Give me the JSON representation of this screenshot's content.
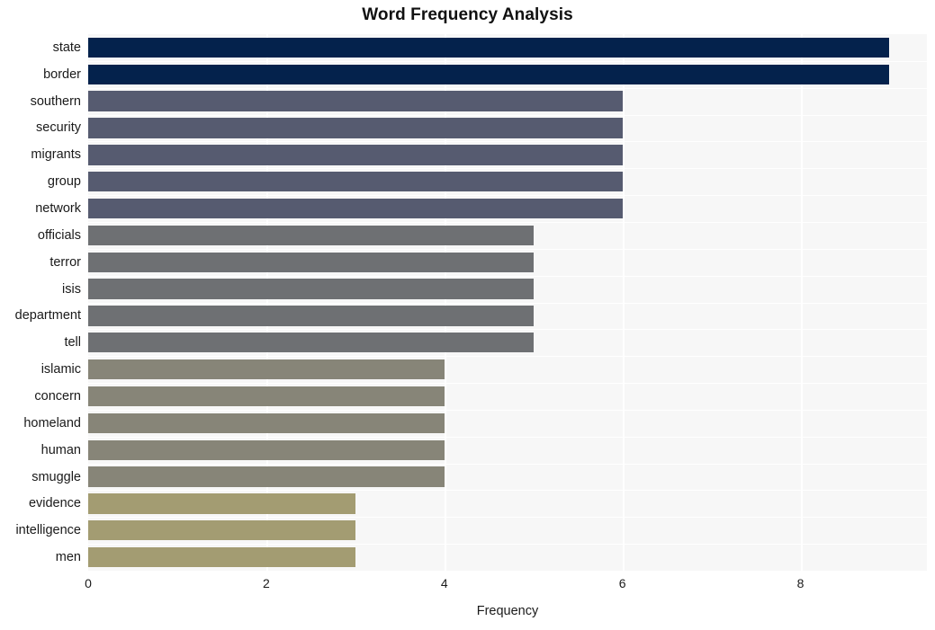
{
  "chart_data": {
    "type": "bar",
    "orientation": "horizontal",
    "title": "Word Frequency Analysis",
    "xlabel": "Frequency",
    "ylabel": "",
    "categories": [
      "state",
      "border",
      "southern",
      "security",
      "migrants",
      "group",
      "network",
      "officials",
      "terror",
      "isis",
      "department",
      "tell",
      "islamic",
      "concern",
      "homeland",
      "human",
      "smuggle",
      "evidence",
      "intelligence",
      "men"
    ],
    "values": [
      9,
      9,
      6,
      6,
      6,
      6,
      6,
      5,
      5,
      5,
      5,
      5,
      4,
      4,
      4,
      4,
      4,
      3,
      3,
      3
    ],
    "bar_colors": [
      "#04224c",
      "#04224c",
      "#565b70",
      "#565b70",
      "#565b70",
      "#565b70",
      "#565b70",
      "#6e7073",
      "#6e7073",
      "#6e7073",
      "#6e7073",
      "#6e7073",
      "#878578",
      "#878578",
      "#878578",
      "#878578",
      "#878578",
      "#a39c72",
      "#a39c72",
      "#a39c72"
    ],
    "xticks": [
      0,
      2,
      4,
      6,
      8
    ],
    "xtick_labels": [
      "0",
      "2",
      "4",
      "6",
      "8"
    ],
    "xlim": [
      0,
      9.42
    ],
    "grid": true,
    "grid_color": "#ffffff",
    "plot_background": "#f7f7f7",
    "figure_background": "#ffffff",
    "legend": null
  }
}
